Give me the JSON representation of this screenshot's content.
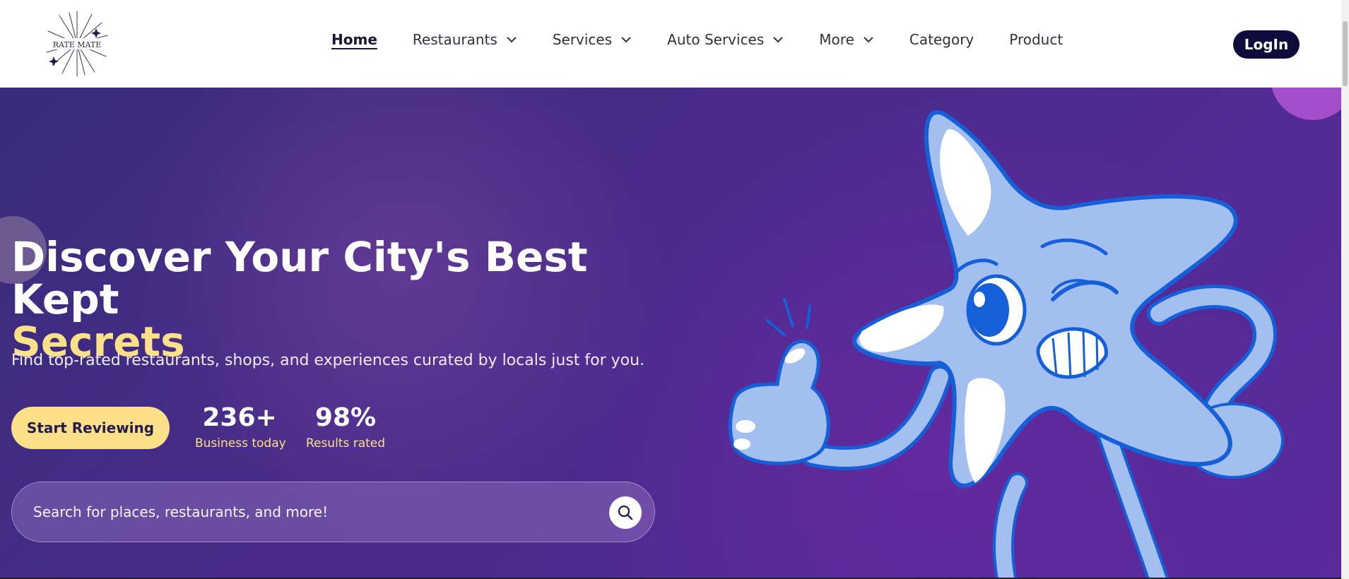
{
  "brand": {
    "logo_text": "RATE MATE"
  },
  "nav": {
    "items": [
      {
        "label": "Home",
        "active": true,
        "dropdown": false
      },
      {
        "label": "Restaurants",
        "active": false,
        "dropdown": true
      },
      {
        "label": "Services",
        "active": false,
        "dropdown": true
      },
      {
        "label": "Auto Services",
        "active": false,
        "dropdown": true
      },
      {
        "label": "More",
        "active": false,
        "dropdown": true
      },
      {
        "label": "Category",
        "active": false,
        "dropdown": false
      },
      {
        "label": "Product",
        "active": false,
        "dropdown": false
      }
    ],
    "login_label": "LogIn"
  },
  "hero": {
    "title_main": "Discover Your City's Best Kept",
    "title_accent": "Secrets",
    "subtitle": "Find top-rated restaurants, shops, and experiences curated by locals just for you.",
    "cta_label": "Start Reviewing",
    "stats": [
      {
        "value": "236+",
        "label": "Business today"
      },
      {
        "value": "98%",
        "label": "Results rated"
      }
    ],
    "search": {
      "placeholder": "Search for places, restaurants, and more!",
      "value": ""
    }
  },
  "colors": {
    "nav_text": "#2f3241",
    "login_bg": "#0f0c3c",
    "accent_yellow": "#fde087",
    "hero_purple": "#4a2b8c",
    "mascot_fill": "#a3bff0",
    "mascot_outline": "#1560d8"
  },
  "icons": {
    "chevron": "chevron-down-icon",
    "search": "search-icon",
    "logo": "logo-icon",
    "mascot": "star-mascot-illustration"
  }
}
